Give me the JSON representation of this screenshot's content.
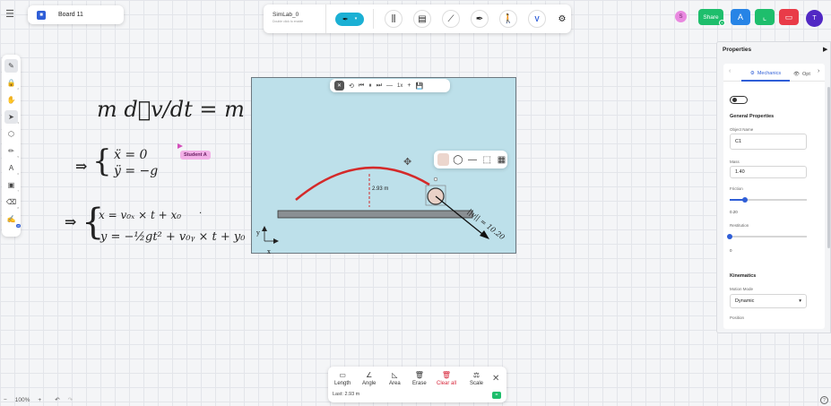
{
  "board": {
    "badge": "■",
    "name": "Board 11"
  },
  "project": {
    "title": "SimLab_0",
    "subtitle": "Double click to enable"
  },
  "toolbar": {
    "active_tool_icon": "✒",
    "dropdown": "▾",
    "tools": [
      {
        "name": "spring",
        "glyph": "⫼"
      },
      {
        "name": "piston",
        "glyph": "▤"
      },
      {
        "name": "rod",
        "glyph": "⟋"
      },
      {
        "name": "thruster",
        "glyph": "✒"
      },
      {
        "name": "ragdoll",
        "glyph": "🚶"
      },
      {
        "name": "vector",
        "glyph": "V"
      }
    ],
    "settings_icon": "⚙"
  },
  "top_right": {
    "avatar_s": "S",
    "share": "Share",
    "share_count": "+",
    "avatar_t": "T"
  },
  "left_toolbar": [
    {
      "name": "select-pen",
      "glyph": "✎",
      "n": ""
    },
    {
      "name": "lock",
      "glyph": "🔒",
      "n": "2"
    },
    {
      "name": "hand",
      "glyph": "✋",
      "n": ""
    },
    {
      "name": "pointer",
      "glyph": "➤",
      "n": "3"
    },
    {
      "name": "shapes",
      "glyph": "⬡",
      "n": ""
    },
    {
      "name": "pencil",
      "glyph": "✏",
      "n": "5"
    },
    {
      "name": "text",
      "glyph": "A",
      "n": "6"
    },
    {
      "name": "image",
      "glyph": "▣",
      "n": "7"
    },
    {
      "name": "eraser",
      "glyph": "⌫",
      "n": "8"
    },
    {
      "name": "ai-pen",
      "glyph": "✍",
      "n": "AI"
    }
  ],
  "math": {
    "eq1": "m d⃗v/dt = m g⃗",
    "implies": "⇒",
    "brace": "{",
    "eq2a": "ẍ = 0",
    "eq2b": "ÿ = −g",
    "eq3a": "x = v₀ₓ × t + x₀",
    "eq3dot": "·",
    "eq3b": "y = −½gt² + v₀ᵧ × t + y₀"
  },
  "cursor_user": "Student A",
  "playbar": {
    "close": "✕",
    "reset": "⟲",
    "prev": "⏮",
    "pause": "⏸",
    "next": "⏭",
    "minus": "—",
    "speed": "1x",
    "plus": "+",
    "save": "💾"
  },
  "shapebar": {
    "fill": "",
    "circle": "◯",
    "line": "—",
    "crop": "⬚",
    "layers": "▦"
  },
  "move_icon": "✥",
  "sim": {
    "height_label": "2.93 m",
    "velocity_label": "||v|| = 10.20",
    "axis_x": "x",
    "axis_y": "y"
  },
  "measure": {
    "tools": [
      {
        "icon": "▭",
        "label": "Length"
      },
      {
        "icon": "∠",
        "label": "Angle"
      },
      {
        "icon": "◺",
        "label": "Area"
      },
      {
        "icon": "🗑",
        "label": "Erase"
      },
      {
        "icon": "🗑",
        "label": "Clear all"
      },
      {
        "icon": "⚖",
        "label": "Scale"
      }
    ],
    "close": "✕",
    "last": "Last: 2.93 m",
    "ok": "="
  },
  "zoom": {
    "minus": "−",
    "value": "100%",
    "plus": "+",
    "undo": "↶",
    "redo": "↷",
    "help": "?"
  },
  "properties": {
    "title": "Properties",
    "collapse": "▶",
    "tabs": {
      "prev": "‹",
      "mechanics": "Mechanics",
      "mech_icon": "⚙",
      "options": "Opt",
      "opt_icon": "👁",
      "next": "›"
    },
    "general_title": "General Properties",
    "object_name_label": "Object Name",
    "object_name": "C1",
    "mass_label": "Mass",
    "mass": "1.40",
    "friction_label": "Friction",
    "friction": "0.20",
    "friction_level": 0.2,
    "restitution_label": "Restitution",
    "restitution": "0",
    "restitution_level": 0,
    "kinematics_title": "Kinematics",
    "motion_mode_label": "Motion Mode",
    "motion_mode": "Dynamic",
    "caret": "▾",
    "position_label": "Position"
  }
}
